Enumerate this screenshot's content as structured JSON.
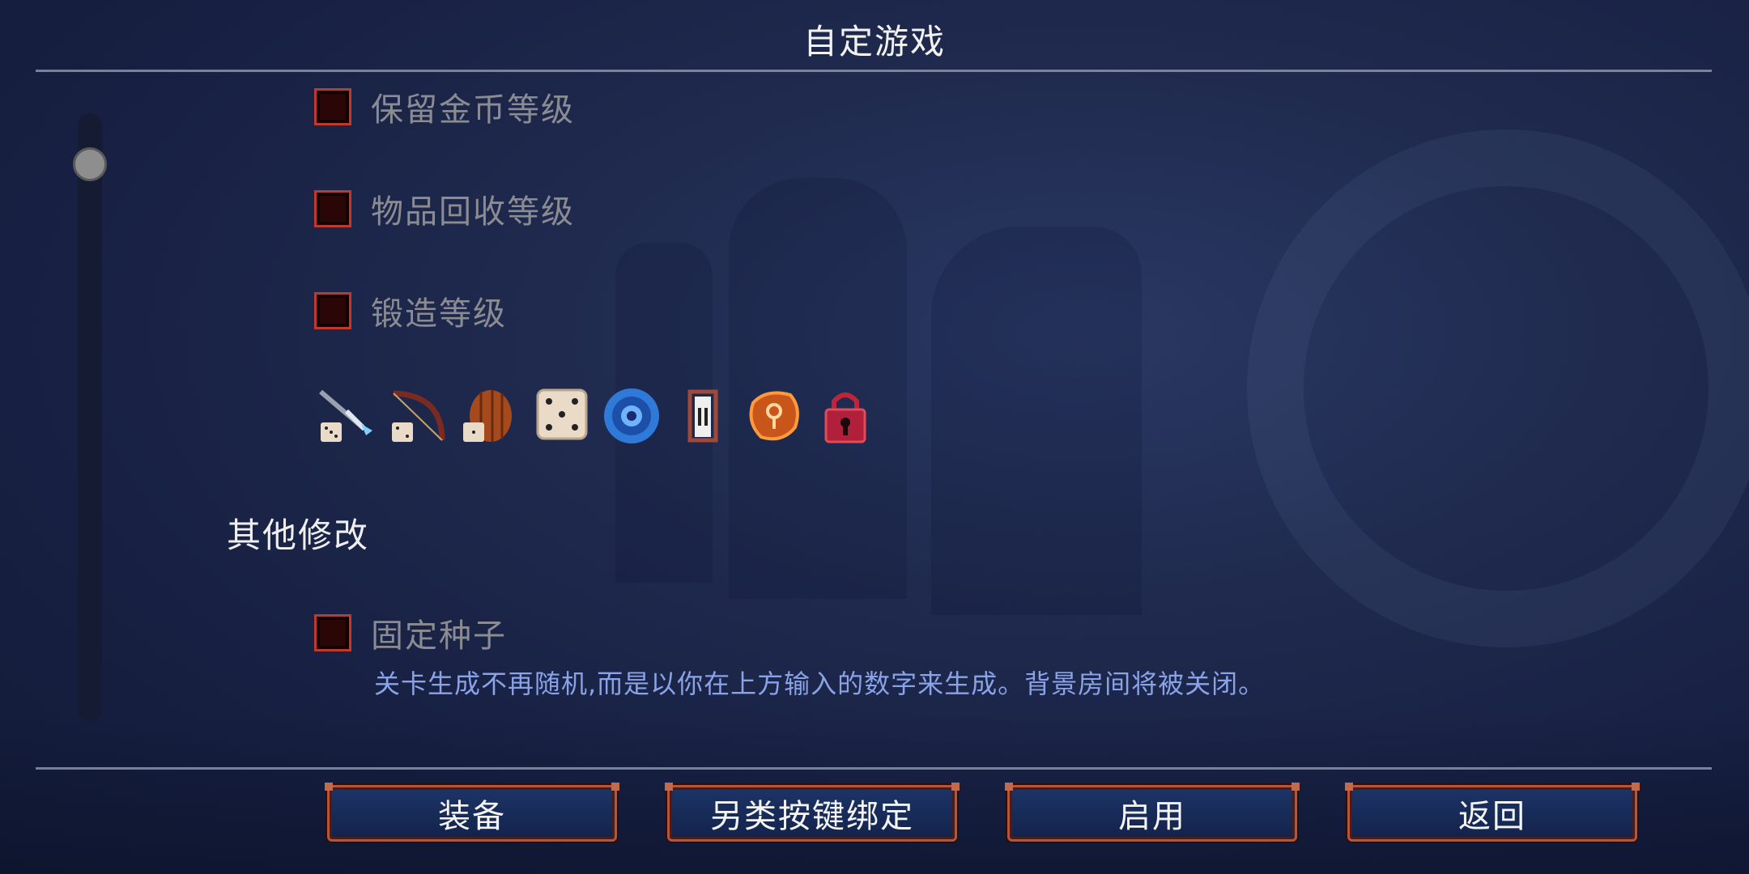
{
  "header": {
    "title": "自定游戏"
  },
  "options": [
    {
      "label": "保留金币等级",
      "checked": false
    },
    {
      "label": "物品回收等级",
      "checked": false
    },
    {
      "label": "锻造等级",
      "checked": false
    }
  ],
  "item_icons": [
    "dagger-dice-icon",
    "bow-dice-icon",
    "shield-dice-icon",
    "dice-icon",
    "blue-rune-orb-icon",
    "door-frame-icon",
    "orange-rune-stone-icon",
    "red-padlock-icon"
  ],
  "other_section": {
    "heading": "其他修改",
    "seed_option": {
      "label": "固定种子",
      "checked": false
    },
    "description": "关卡生成不再随机,而是以你在上方输入的数字来生成。背景房间将被关闭。"
  },
  "footer": {
    "equip_label": "装备",
    "alt_bindings_label": "另类按键绑定",
    "enable_label": "启用",
    "back_label": "返回"
  },
  "colors": {
    "checkbox_border": "#c2382c",
    "description_text": "#8aa2e8",
    "button_border": "#b4553f"
  }
}
